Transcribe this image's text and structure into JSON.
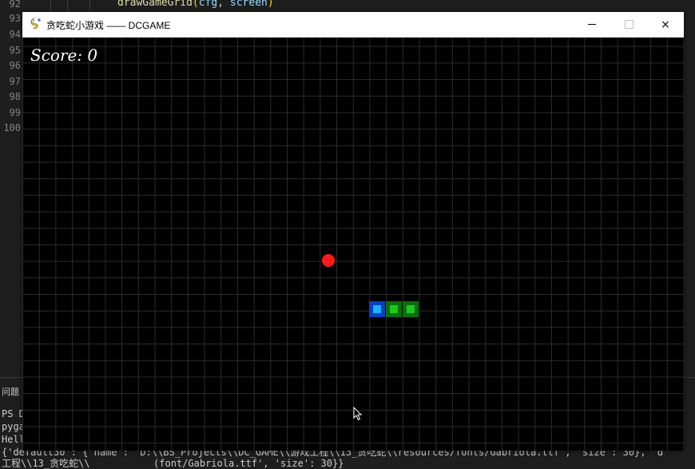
{
  "editor": {
    "line_numbers": [
      "92",
      "93",
      "94",
      "95",
      "96",
      "97",
      "98",
      "99",
      "100"
    ],
    "code_tokens": {
      "fn": "drawGameGrid",
      "open": "(",
      "arg1": "cfg",
      "comma": ", ",
      "arg2": "screen",
      "close": ")"
    },
    "terminal": {
      "problems_label": "问题",
      "lines": [
        "PS D",
        "pyga",
        "Hell",
        "{'default30': {'name': 'D:\\\\BS_Projects\\\\DC_GAME\\\\游戏工程\\\\13_贪吃蛇\\\\resources/fonts/Gabriola.ttf', 'size': 30}, 'd",
        "工程\\\\13_贪吃蛇\\\\           (font/Gabriola.ttf', 'size': 30}}"
      ]
    }
  },
  "window": {
    "title": "贪吃蛇小游戏 —— DCGAME",
    "icon": "pygame-snake-icon",
    "controls": {
      "minimize": "minimize",
      "maximize": "maximize",
      "close": "×"
    }
  },
  "game": {
    "score_text": "Score: 0",
    "colors": {
      "grid": "#2c2c2c",
      "food": "#ff1a1a",
      "head": "#18b4ff",
      "body": "#1dc81d"
    }
  }
}
